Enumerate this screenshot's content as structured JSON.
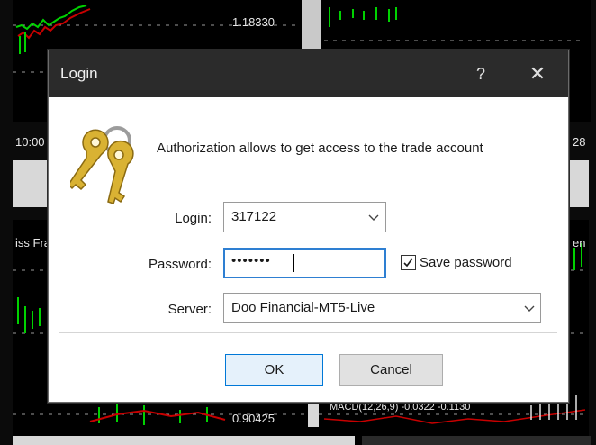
{
  "background": {
    "price_top": "1.18330",
    "price_bottom": "0.90425",
    "time_left": "10:00",
    "time_right": "28",
    "chart_tag_left": "iss Fra",
    "chart_tag_right": "en",
    "indicator_label": "MACD(12,26,9) -0.0322 -0.1130"
  },
  "dialog": {
    "title": "Login",
    "help": "?",
    "close": "✕",
    "message": "Authorization allows to get access to the trade account",
    "login_label": "Login:",
    "login_value": "317122",
    "password_label": "Password:",
    "password_masked": "•••••••",
    "save_password_label": "Save password",
    "save_password_checked": true,
    "server_label": "Server:",
    "server_value": "Doo Financial-MT5-Live",
    "ok_label": "OK",
    "cancel_label": "Cancel"
  },
  "colors": {
    "titlebar": "#2b2b2b",
    "focus_border": "#2e7fd2",
    "ok_border": "#0078d7",
    "chart_green": "#00d200",
    "chart_red": "#c80000"
  }
}
